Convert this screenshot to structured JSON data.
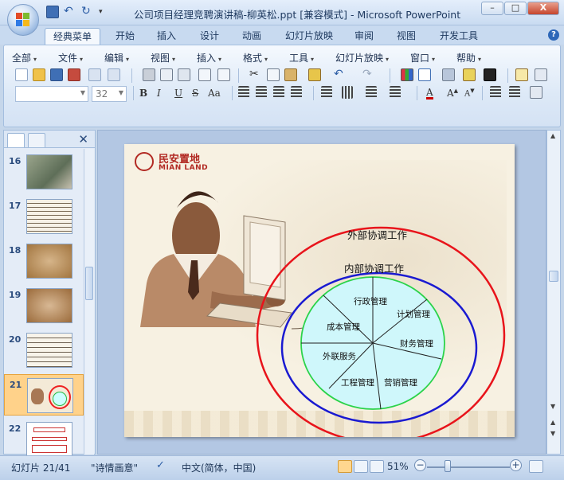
{
  "window": {
    "title": "公司项目经理竞聘演讲稿-柳英松.ppt [兼容模式] - Microsoft PowerPoint",
    "controls": {
      "minimize": "–",
      "restore": "□",
      "close": "X"
    }
  },
  "ribbon_tabs": [
    {
      "label": "经典菜单",
      "active": true
    },
    {
      "label": "开始"
    },
    {
      "label": "插入"
    },
    {
      "label": "设计"
    },
    {
      "label": "动画"
    },
    {
      "label": "幻灯片放映"
    },
    {
      "label": "审阅"
    },
    {
      "label": "视图"
    },
    {
      "label": "开发工具"
    }
  ],
  "menu": [
    "全部",
    "文件",
    "编辑",
    "视图",
    "插入",
    "格式",
    "工具",
    "幻灯片放映",
    "窗口",
    "帮助"
  ],
  "font": {
    "name": "",
    "size": "32"
  },
  "format_buttons": {
    "bold": "B",
    "italic": "I",
    "underline": "U",
    "strike": "S",
    "case": "Aa"
  },
  "slides_pane": {
    "thumbnails": [
      {
        "num": "16"
      },
      {
        "num": "17"
      },
      {
        "num": "18"
      },
      {
        "num": "19"
      },
      {
        "num": "20"
      },
      {
        "num": "21",
        "selected": true
      },
      {
        "num": "22"
      }
    ]
  },
  "slide": {
    "logo_cn": "民安置地",
    "logo_en": "MIAN LAND",
    "outer_label": "外部协调工作",
    "inner_label": "内部协调工作",
    "segments": [
      "行政管理",
      "计划管理",
      "财务管理",
      "营销管理",
      "工程管理",
      "外联服务",
      "成本管理"
    ],
    "colors": {
      "outer_oval": "#e8141b",
      "inner_oval": "#1a1ad1",
      "pie_fill": "#cff7fb",
      "pie_border": "#2bd34a"
    }
  },
  "status": {
    "slide_info": "幻灯片 21/41",
    "theme": "\"诗情画意\"",
    "language": "中文(简体，中国)",
    "zoom": "51%"
  }
}
